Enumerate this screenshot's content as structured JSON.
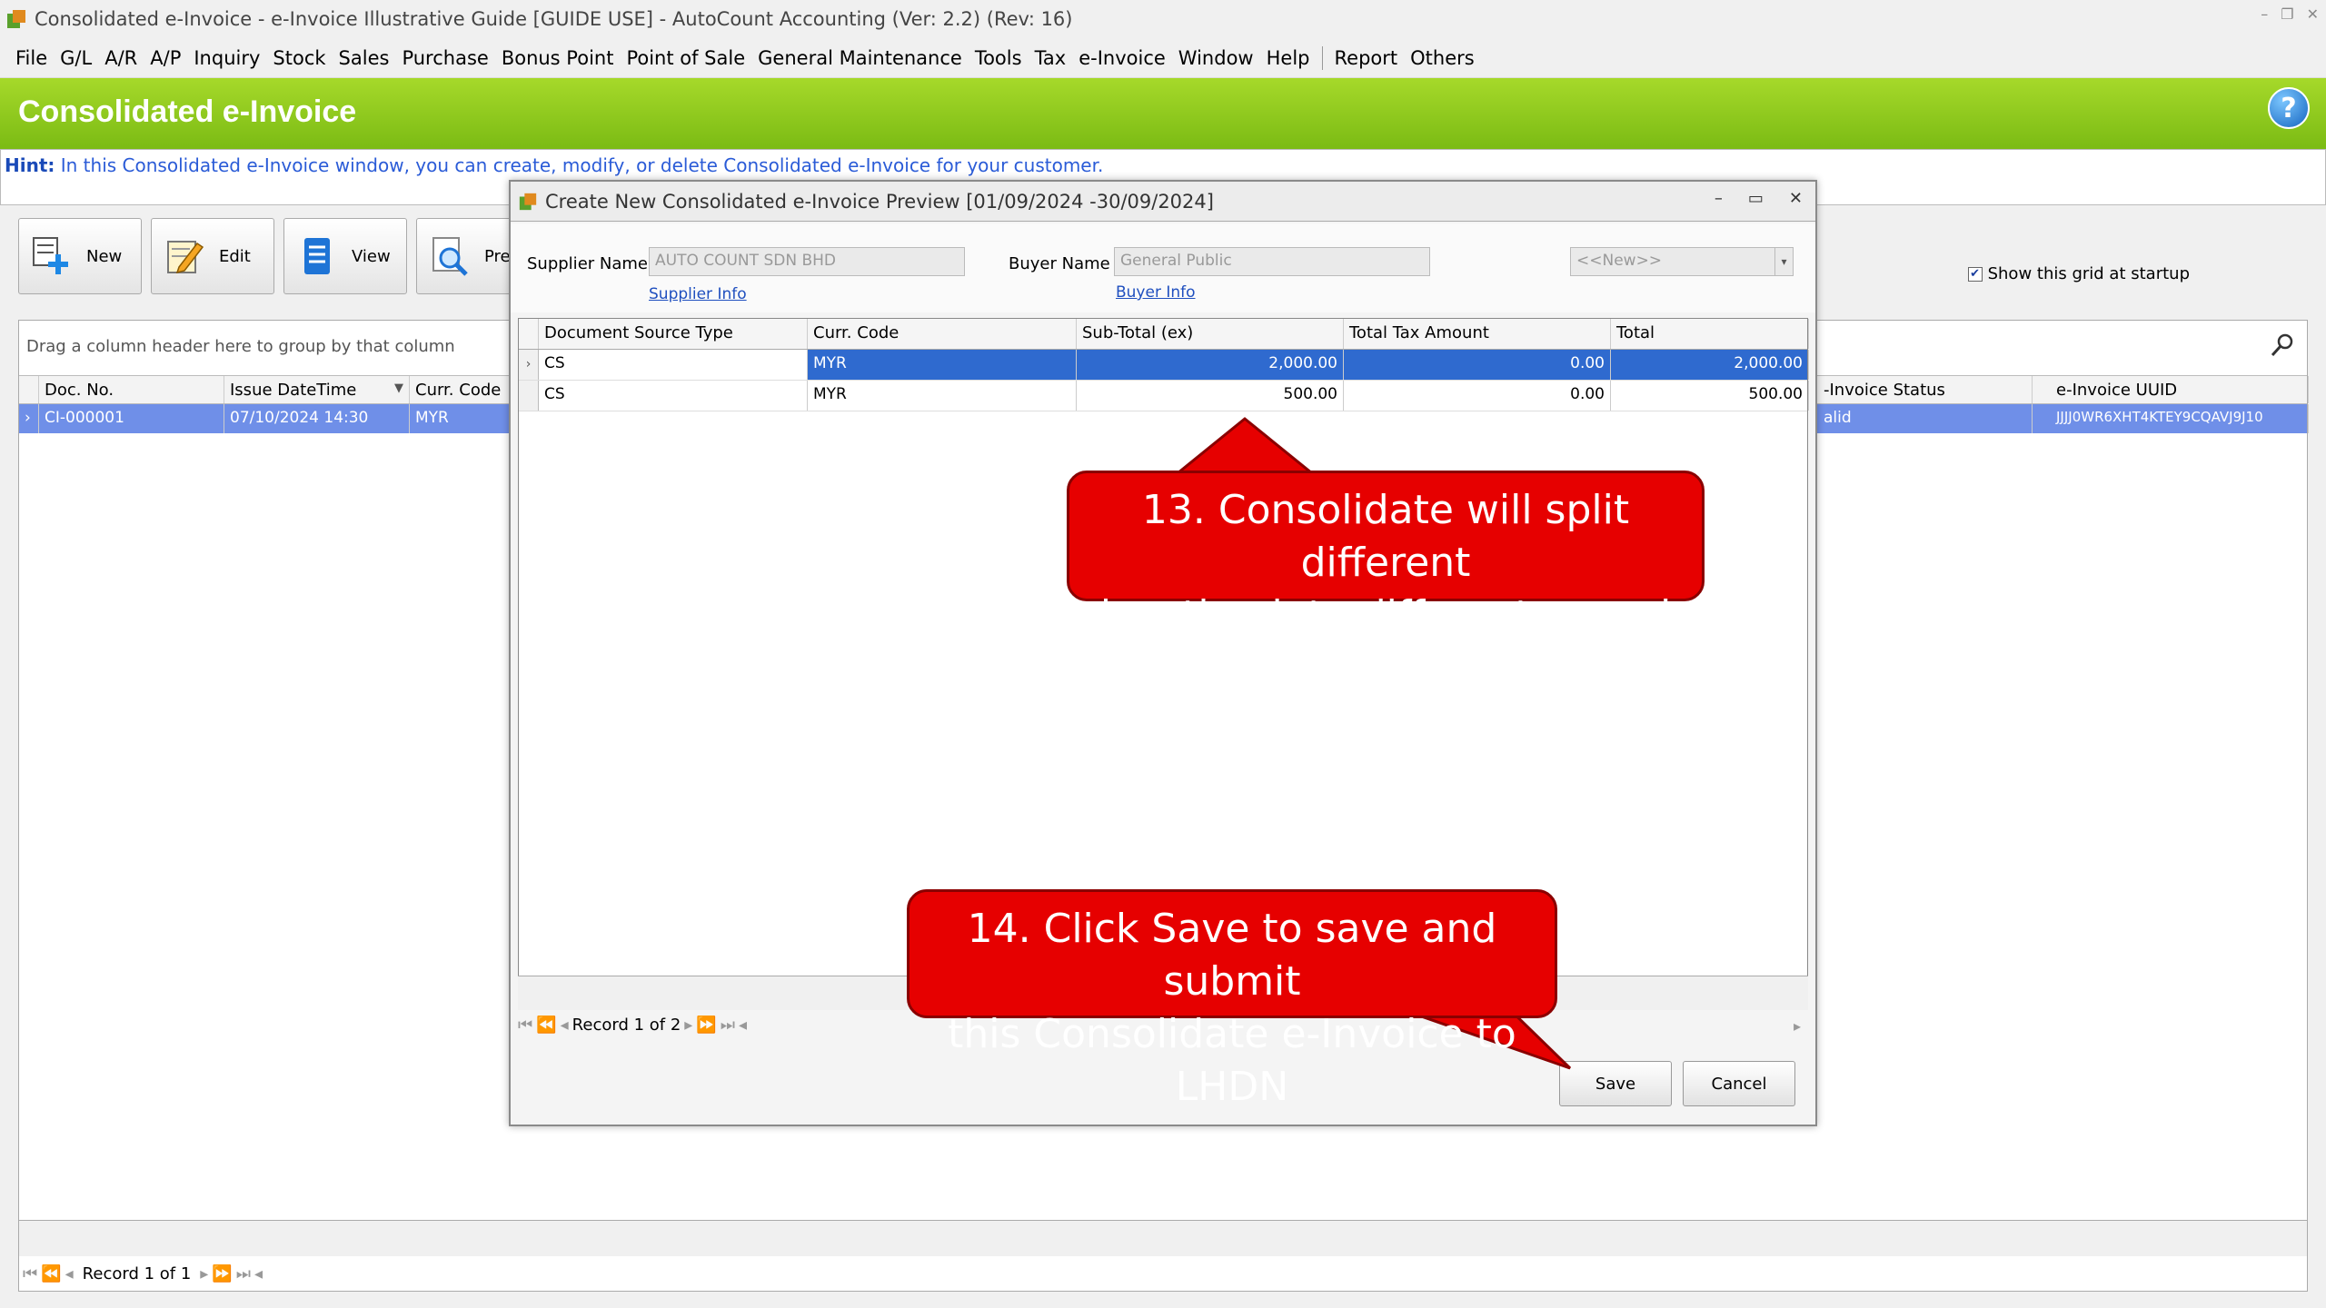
{
  "window": {
    "title": "Consolidated e-Invoice - e-Invoice Illustrative Guide [GUIDE USE] - AutoCount Accounting (Ver: 2.2) (Rev: 16)"
  },
  "menu": [
    "File",
    "G/L",
    "A/R",
    "A/P",
    "Inquiry",
    "Stock",
    "Sales",
    "Purchase",
    "Bonus Point",
    "Point of Sale",
    "General Maintenance",
    "Tools",
    "Tax",
    "e-Invoice",
    "Window",
    "Help"
  ],
  "menu_extra": [
    "Report",
    "Others"
  ],
  "banner": {
    "title": "Consolidated e-Invoice",
    "help": "?"
  },
  "hint": {
    "label": "Hint:",
    "text": "In this Consolidated e-Invoice window, you can create, modify, or delete Consolidated e-Invoice for your customer."
  },
  "toolbar": {
    "new": "New",
    "edit": "Edit",
    "view": "View",
    "preview": "Pre"
  },
  "show_grid_label": "Show this grid at startup",
  "main_grid": {
    "group_hint": "Drag a column header here to group by that column",
    "columns": {
      "doc_no": "Doc. No.",
      "issue": "Issue DateTime",
      "curr": "Curr. Code",
      "status": "-Invoice Status",
      "uuid": "e-Invoice UUID"
    },
    "row": {
      "doc_no": "CI-000001",
      "issue": "07/10/2024 14:30",
      "curr": "MYR",
      "status": "alid",
      "uuid": "JJJJ0WR6XHT4KTEY9CQAVJ9J10"
    },
    "record": "Record 1 of 1"
  },
  "dialog": {
    "title": "Create New Consolidated e-Invoice Preview [01/09/2024 -30/09/2024]",
    "supplier_label": "Supplier Name",
    "supplier_value": "AUTO COUNT SDN BHD",
    "supplier_link": "Supplier Info",
    "buyer_label": "Buyer Name",
    "buyer_value": "General Public",
    "buyer_link": "Buyer Info",
    "combo_value": "<<New>>",
    "columns": {
      "source": "Document Source Type",
      "curr": "Curr. Code",
      "subtotal": "Sub-Total (ex)",
      "tax": "Total Tax Amount",
      "total": "Total"
    },
    "rows": [
      {
        "source": "CS",
        "curr": "MYR",
        "subtotal": "2,000.00",
        "tax": "0.00",
        "total": "2,000.00"
      },
      {
        "source": "CS",
        "curr": "MYR",
        "subtotal": "500.00",
        "tax": "0.00",
        "total": "500.00"
      }
    ],
    "record": "Record 1 of 2",
    "save": "Save",
    "cancel": "Cancel"
  },
  "callouts": {
    "c13_line1": "13. Consolidate will split different",
    "c13_line2": "location into different record",
    "c14_line1": "14. Click Save to save and submit",
    "c14_line2": "this Consolidate e-Invoice to LHDN"
  },
  "colors": {
    "banner": "#8cc81e",
    "selection": "#2f6acf",
    "callout": "#e60000"
  }
}
